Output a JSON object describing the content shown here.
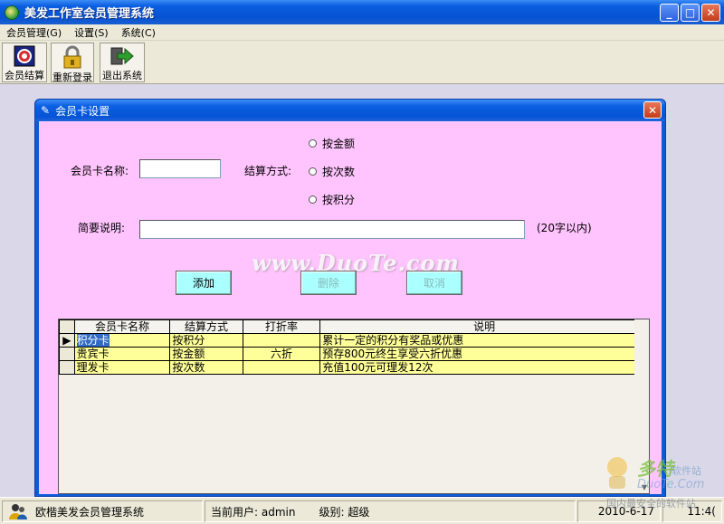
{
  "window": {
    "title": "美发工作室会员管理系统"
  },
  "menu": {
    "items": [
      "会员管理(G)",
      "设置(S)",
      "系统(C)"
    ]
  },
  "toolbar": {
    "buttons": [
      {
        "label": "会员结算",
        "icon": "target-icon"
      },
      {
        "label": "重新登录",
        "icon": "lock-icon"
      },
      {
        "label": "退出系统",
        "icon": "exit-arrow-icon"
      }
    ]
  },
  "dialog": {
    "title": "会员卡设置",
    "name_label": "会员卡名称:",
    "name_value": "",
    "method_label": "结算方式:",
    "radios": [
      "按金额",
      "按次数",
      "按积分"
    ],
    "desc_label": "简要说明:",
    "desc_value": "",
    "desc_hint": "(20字以内)",
    "buttons": {
      "add": "添加",
      "delete": "删除",
      "cancel": "取消"
    },
    "watermark": "www.DuoTe.com",
    "grid": {
      "headers": [
        "会员卡名称",
        "结算方式",
        "打折率",
        "说明"
      ],
      "rows": [
        {
          "name": "积分卡",
          "method": "按积分",
          "discount": "",
          "desc": "累计一定的积分有奖品或优惠"
        },
        {
          "name": "贵宾卡",
          "method": "按金额",
          "discount": "六折",
          "desc": "预存800元终生享受六折优惠"
        },
        {
          "name": "理发卡",
          "method": "按次数",
          "discount": "",
          "desc": "充值100元可理发12次"
        }
      ]
    }
  },
  "statusbar": {
    "app_name": "欧楷美发会员管理系统",
    "user": "当前用户: admin",
    "level": "级别: 超级",
    "date": "2010-6-17",
    "time": "11:4("
  },
  "corner_logo": {
    "l1": "多特",
    "l1s": "软件站",
    "l2": "DuoTe.Com",
    "l3": "国内最安全的软件站"
  },
  "colors": {
    "dialog_bg": "#ffc4fd",
    "button_bg": "#aaffff",
    "grid_row": "#ffff99",
    "titlebar": "#0a5ee0"
  }
}
